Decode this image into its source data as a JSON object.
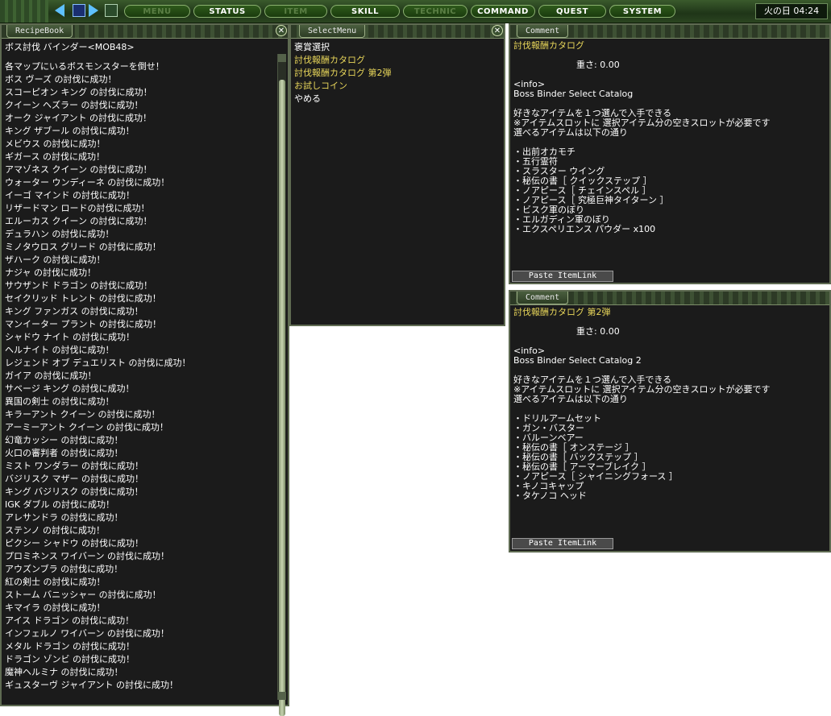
{
  "menubar": {
    "buttons": [
      {
        "label": "MENU",
        "dim": true
      },
      {
        "label": "STATUS",
        "dim": false
      },
      {
        "label": "ITEM",
        "dim": true
      },
      {
        "label": "SKILL",
        "dim": false
      },
      {
        "label": "TECHNIC",
        "dim": true
      },
      {
        "label": "COMMAND",
        "dim": false
      },
      {
        "label": "QUEST",
        "dim": false
      },
      {
        "label": "SYSTEM",
        "dim": false
      }
    ],
    "clock": "火の日 04:24"
  },
  "recipe": {
    "tab": "RecipeBook",
    "title": "ボス討伐 バインダー<MOB48>",
    "lines": [
      "各マップにいるボスモンスターを倒せ！",
      "ボス ヴーズ の討伐に成功！",
      "スコーピオン キング の討伐に成功！",
      "クイーン ヘズラー の討伐に成功！",
      "オーク ジャイアント の討伐に成功！",
      "キング ザブール の討伐に成功！",
      "メビウス の討伐に成功！",
      "ギガース の討伐に成功！",
      "アマゾネス クイーン の討伐に成功！",
      "ウォーター ウンディーネ の討伐に成功！",
      "イーゴ マインド の討伐に成功！",
      "リザードマン ロードの討伐に成功！",
      "エルーカス クイーン の討伐に成功！",
      "デュラハン の討伐に成功！",
      "ミノタウロス グリード の討伐に成功！",
      "ザハーク の討伐に成功！",
      "ナジャ の討伐に成功！",
      "サウザンド ドラゴン の討伐に成功！",
      "セイクリッド トレント の討伐に成功！",
      "キング ファンガス の討伐に成功！",
      "マンイーター プラント の討伐に成功！",
      "シャドウ ナイト の討伐に成功！",
      "ヘルナイト の討伐に成功！",
      "レジェンド オブ デュエリスト の討伐に成功！",
      "ガイア の討伐に成功！",
      "サベージ キング の討伐に成功！",
      "異国の剣士 の討伐に成功！",
      "キラーアント クイーン の討伐に成功！",
      "アーミーアント クイーン の討伐に成功！",
      "幻竜カッシー の討伐に成功！",
      "火口の審判者 の討伐に成功！",
      "ミスト ワンダラー の討伐に成功！",
      "バジリスク マザー の討伐に成功！",
      "キング バジリスク の討伐に成功！",
      "IGK ダブル の討伐に成功！",
      "アレサンドラ の討伐に成功！",
      "ステンノ の討伐に成功！",
      "ピクシー シャドウ の討伐に成功！",
      "プロミネンス ワイバーン の討伐に成功！",
      "アウズンブラ の討伐に成功！",
      "紅の剣士 の討伐に成功！",
      "ストーム バニッシャー の討伐に成功！",
      "キマイラ の討伐に成功！",
      "アイス ドラゴン の討伐に成功！",
      "インフェルノ ワイバーン の討伐に成功！",
      "メタル ドラゴン の討伐に成功！",
      "ドラゴン ゾンビ の討伐に成功！",
      "魔神ヘルミナ の討伐に成功！",
      "ギュスターヴ ジャイアント の討伐に成功！"
    ]
  },
  "select": {
    "tab": "SelectMenu",
    "header": "褒賞選択",
    "options": [
      {
        "label": "討伐報酬カタログ",
        "highlight": true
      },
      {
        "label": "討伐報酬カタログ 第2弾",
        "highlight": true
      },
      {
        "label": "お試しコイン",
        "highlight": true
      },
      {
        "label": "やめる",
        "highlight": false
      }
    ]
  },
  "comment1": {
    "tab": "Comment",
    "name": "討伐報酬カタログ",
    "weight": "重さ: 0.00",
    "info_tag": "<info>",
    "subtitle": "Boss Binder Select Catalog",
    "desc": [
      "好きなアイテムを１つ選んで入手できる",
      "※アイテムスロットに 選択アイテム分の空きスロットが必要です",
      "選べるアイテムは以下の通り"
    ],
    "items": [
      "・出前オカモチ",
      "・五行霊符",
      "・スラスター ウイング",
      "・秘伝の書［ クイックステップ ］",
      "・ノアピース［ チェインスペル ］",
      "・ノアピース［ 究極巨神タイターン ］",
      "・ビスク軍のぼり",
      "・エルガディン軍のぼり",
      "・エクスペリエンス パウダー x100"
    ],
    "paste": "Paste ItemLink"
  },
  "comment2": {
    "tab": "Comment",
    "name": "討伐報酬カタログ 第2弾",
    "weight": "重さ: 0.00",
    "info_tag": "<info>",
    "subtitle": "Boss Binder Select Catalog 2",
    "desc": [
      "好きなアイテムを１つ選んで入手できる",
      "※アイテムスロットに 選択アイテム分の空きスロットが必要です",
      "選べるアイテムは以下の通り"
    ],
    "items": [
      "・ドリルアームセット",
      "・ガン・バスター",
      "・バルーンベアー",
      "・秘伝の書［ オンステージ ］",
      "・秘伝の書［ バックステップ ］",
      "・秘伝の書［ アーマーブレイク ］",
      "・ノアピース［ シャイニングフォース ］",
      "・キノコキャップ",
      "・タケノコ ヘッド"
    ],
    "paste": "Paste ItemLink"
  }
}
